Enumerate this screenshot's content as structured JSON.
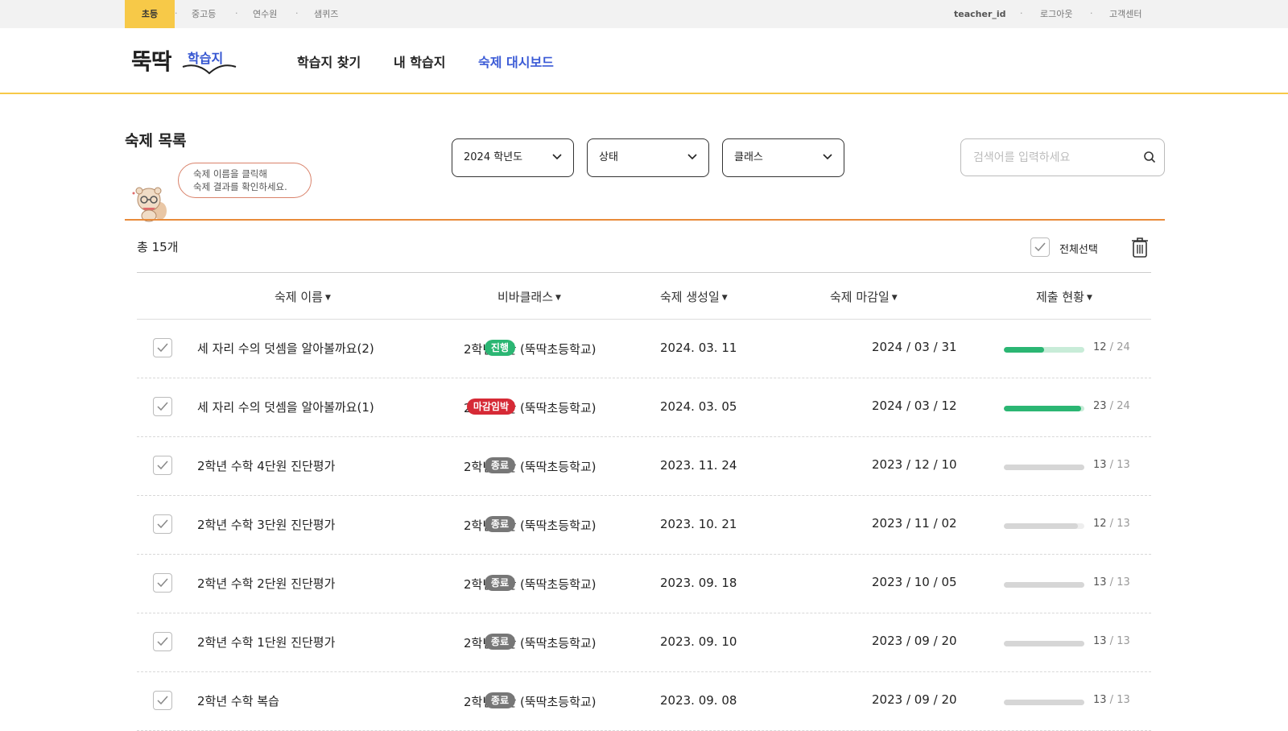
{
  "topbar": {
    "tabs": [
      "초등",
      "중고등",
      "연수원",
      "샘퀴즈"
    ],
    "user_id": "teacher_id",
    "logout": "로그아웃",
    "support": "고객센터"
  },
  "logo": {
    "big": "뚝딱",
    "small": "학습지"
  },
  "nav": {
    "items": [
      "학습지 찾기",
      "내 학습지",
      "숙제 대시보드"
    ],
    "active_index": 2
  },
  "page": {
    "title": "숙제 목록",
    "tip_line1": "숙제 이름을 클릭해",
    "tip_line2": "숙제 결과를 확인하세요."
  },
  "filters": {
    "year": "2024 학년도",
    "status": "상태",
    "class": "클래스",
    "search_placeholder": "검색어를 입력하세요"
  },
  "summary": {
    "total_prefix": "총",
    "total_count": "15개",
    "select_all": "전체선택"
  },
  "table": {
    "headers": [
      "숙제 이름",
      "비바클래스",
      "숙제 생성일",
      "숙제 마감일",
      "제출 현황"
    ],
    "rows": [
      {
        "name": "세 자리 수의 덧셈을 알아볼까요(2)",
        "class": "2학년 1반 (뚝딱초등학교)",
        "created": "2024. 03. 11",
        "status": "진행",
        "status_color": "#2bb673",
        "due": "2024 / 03 / 31",
        "submitted": "12",
        "total": "24",
        "progress": 0.5,
        "bar_color": "#2bb673",
        "bar_bg": "#c8ecd8"
      },
      {
        "name": "세 자리 수의 덧셈을 알아볼까요(1)",
        "class": "2학년 1반 (뚝딱초등학교)",
        "created": "2024. 03. 05",
        "status": "마감임박",
        "status_color": "#d62a36",
        "due": "2024 / 03 / 12",
        "submitted": "23",
        "total": "24",
        "progress": 0.958,
        "bar_color": "#2bb673",
        "bar_bg": "#c8ecd8"
      },
      {
        "name": "2학년 수학 4단원 진단평가",
        "class": "2학년 2반 (뚝딱초등학교)",
        "created": "2023. 11. 24",
        "status": "종료",
        "status_color": "#777777",
        "due": "2023 / 12 / 10",
        "submitted": "13",
        "total": "13",
        "progress": 1.0,
        "bar_color": "#d6d6d6",
        "bar_bg": "#e6e6e6"
      },
      {
        "name": "2학년 수학 3단원 진단평가",
        "class": "2학년 2반 (뚝딱초등학교)",
        "created": "2023. 10. 21",
        "status": "종료",
        "status_color": "#777777",
        "due": "2023 / 11 / 02",
        "submitted": "12",
        "total": "13",
        "progress": 0.923,
        "bar_color": "#d6d6d6",
        "bar_bg": "#eeeeee"
      },
      {
        "name": "2학년 수학 2단원 진단평가",
        "class": "2학년 2반 (뚝딱초등학교)",
        "created": "2023. 09. 18",
        "status": "종료",
        "status_color": "#777777",
        "due": "2023 / 10 / 05",
        "submitted": "13",
        "total": "13",
        "progress": 1.0,
        "bar_color": "#d6d6d6",
        "bar_bg": "#e6e6e6"
      },
      {
        "name": "2학년 수학 1단원 진단평가",
        "class": "2학년 2반 (뚝딱초등학교)",
        "created": "2023. 09. 10",
        "status": "종료",
        "status_color": "#777777",
        "due": "2023 / 09 / 20",
        "submitted": "13",
        "total": "13",
        "progress": 1.0,
        "bar_color": "#d6d6d6",
        "bar_bg": "#e6e6e6"
      },
      {
        "name": "2학년 수학 복습",
        "class": "2학년 2반 (뚝딱초등학교)",
        "created": "2023. 09. 08",
        "status": "종료",
        "status_color": "#777777",
        "due": "2023 / 09 / 20",
        "submitted": "13",
        "total": "13",
        "progress": 1.0,
        "bar_color": "#d6d6d6",
        "bar_bg": "#e6e6e6"
      }
    ]
  },
  "colors": {
    "accent_yellow": "#f7c948",
    "accent_blue": "#3b5bd6",
    "accent_orange": "#e98b3a"
  },
  "icons": [
    "chevron-down-icon",
    "search-icon",
    "check-icon",
    "trash-icon",
    "sort-triangle-icon"
  ]
}
